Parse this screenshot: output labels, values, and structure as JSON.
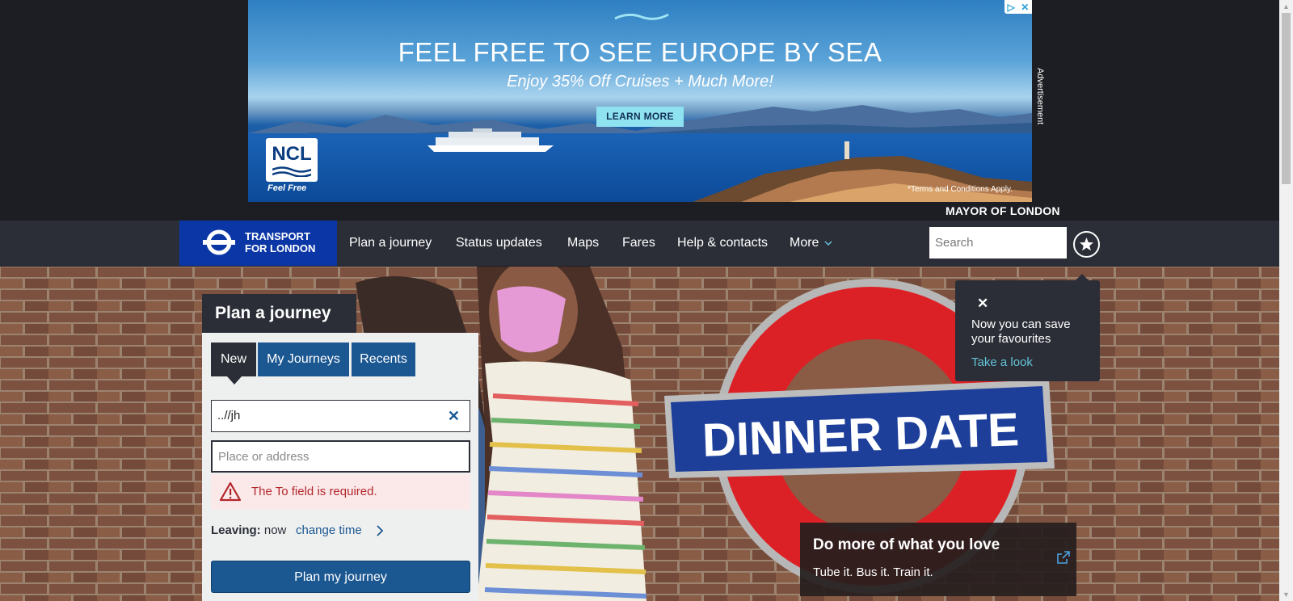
{
  "ad": {
    "headline": "FEEL FREE TO SEE EUROPE BY SEA",
    "subheadline": "Enjoy 35% Off Cruises + Much More!",
    "cta": "LEARN MORE",
    "brand": "NCL",
    "brand_tagline": "Feel Free",
    "terms": "*Terms and Conditions Apply.",
    "label": "Advertisement",
    "adchoices_icons": [
      "adchoices-icon",
      "close-icon"
    ]
  },
  "header": {
    "mayor": "MAYOR OF LONDON",
    "brand_line1": "TRANSPORT",
    "brand_line2": "FOR LONDON"
  },
  "nav": {
    "items": [
      "Plan a journey",
      "Status updates",
      "Maps",
      "Fares",
      "Help & contacts",
      "More"
    ],
    "search_placeholder": "Search"
  },
  "favourites_tooltip": {
    "close": "✕",
    "message": "Now you can save your favourites",
    "link": "Take a look"
  },
  "journey": {
    "title": "Plan a journey",
    "tabs": [
      "New",
      "My Journeys",
      "Recents"
    ],
    "from_value": "..//jh",
    "to_placeholder": "Place or address",
    "error": "The To field is required.",
    "leaving_label": "Leaving:",
    "leaving_value": "now",
    "change_time": "change time",
    "submit": "Plan my journey"
  },
  "hero": {
    "sign_text": "DINNER DATE"
  },
  "promo": {
    "title": "Do more of what you love",
    "subtitle": "Tube it. Bus it. Train it."
  },
  "colors": {
    "tfl_blue": "#0b37a6",
    "nav_dark": "#2b2e37",
    "button_blue": "#1b5791",
    "error_red": "#b2262a",
    "link_teal": "#62c3d6"
  }
}
